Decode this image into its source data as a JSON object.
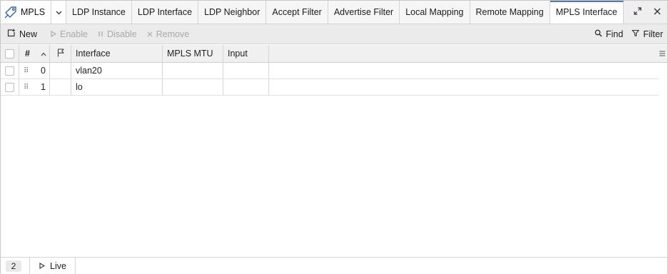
{
  "app": {
    "title": "MPLS"
  },
  "tabs": [
    {
      "label": "LDP Instance",
      "active": false
    },
    {
      "label": "LDP Interface",
      "active": false
    },
    {
      "label": "LDP Neighbor",
      "active": false
    },
    {
      "label": "Accept Filter",
      "active": false
    },
    {
      "label": "Advertise Filter",
      "active": false
    },
    {
      "label": "Local Mapping",
      "active": false
    },
    {
      "label": "Remote Mapping",
      "active": false
    },
    {
      "label": "MPLS Interface",
      "active": true
    }
  ],
  "toolbar": {
    "new_label": "New",
    "enable_label": "Enable",
    "disable_label": "Disable",
    "remove_label": "Remove",
    "find_label": "Find",
    "filter_label": "Filter"
  },
  "table": {
    "columns": {
      "num": "#",
      "interface": "Interface",
      "mpls_mtu": "MPLS MTU",
      "input": "Input"
    },
    "rows": [
      {
        "num": "0",
        "interface": "vlan20",
        "mpls_mtu": "",
        "input": ""
      },
      {
        "num": "1",
        "interface": "lo",
        "mpls_mtu": "",
        "input": ""
      }
    ]
  },
  "status": {
    "count": "2",
    "live_label": "Live"
  },
  "colors": {
    "accent": "#3d7ecf",
    "tabbar_bg": "#efefef",
    "toolbar_bg": "#ebebeb"
  }
}
